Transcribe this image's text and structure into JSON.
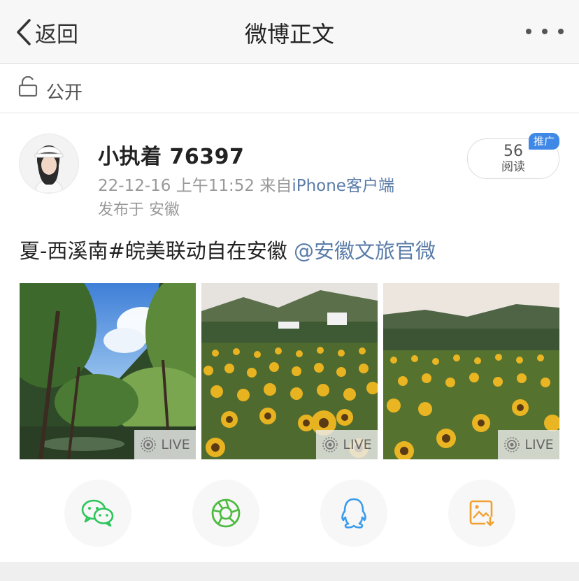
{
  "nav": {
    "back_label": "返回",
    "title": "微博正文"
  },
  "visibility": {
    "label": "公开"
  },
  "post": {
    "username": "小执着 76397",
    "time": "22-12-16 上午11:52",
    "source_prefix": "来自",
    "source": "iPhone客户端",
    "location": "发布于 安徽",
    "reads_count": "56",
    "reads_label": "阅读",
    "promo_badge": "推广",
    "text": "夏-西溪南#皖美联动自在安徽",
    "mention": "@安徽文旅官微"
  },
  "photos": [
    {
      "subject": "trees and sky",
      "live_label": "LIVE"
    },
    {
      "subject": "sunflower field with houses",
      "live_label": "LIVE"
    },
    {
      "subject": "sunflower field with hills",
      "live_label": "LIVE"
    }
  ],
  "share_targets": [
    {
      "icon": "wechat-icon",
      "color": "#2dc55b"
    },
    {
      "icon": "moments-icon",
      "color": "#4cba3f"
    },
    {
      "icon": "qq-icon",
      "color": "#3a9bec"
    },
    {
      "icon": "save-image-icon",
      "color": "#f0a030"
    }
  ],
  "colors": {
    "link": "#5a7ca8",
    "promo": "#3f88e6",
    "nav_bg": "#f7f7f7"
  }
}
